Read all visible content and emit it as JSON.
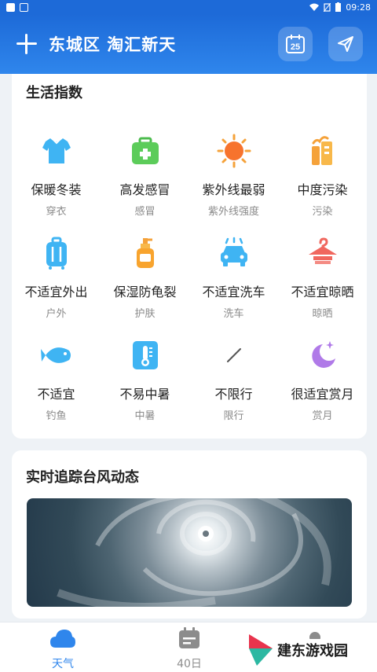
{
  "statusbar": {
    "time": "09:28"
  },
  "header": {
    "location": "东城区 淘汇新天",
    "calendar_day": "25"
  },
  "life_index": {
    "title": "生活指数",
    "items": [
      {
        "value": "保暖冬装",
        "category": "穿衣",
        "icon": "shirt-icon"
      },
      {
        "value": "高发感冒",
        "category": "感冒",
        "icon": "medkit-icon"
      },
      {
        "value": "紫外线最弱",
        "category": "紫外线强度",
        "icon": "sun-icon"
      },
      {
        "value": "中度污染",
        "category": "污染",
        "icon": "pollution-icon"
      },
      {
        "value": "不适宜外出",
        "category": "户外",
        "icon": "luggage-icon"
      },
      {
        "value": "保湿防龟裂",
        "category": "护肤",
        "icon": "lotion-icon"
      },
      {
        "value": "不适宜洗车",
        "category": "洗车",
        "icon": "car-icon"
      },
      {
        "value": "不适宜晾晒",
        "category": "晾晒",
        "icon": "hanger-icon"
      },
      {
        "value": "不适宜",
        "category": "钓鱼",
        "icon": "fish-icon"
      },
      {
        "value": "不易中暑",
        "category": "中暑",
        "icon": "thermometer-icon"
      },
      {
        "value": "不限行",
        "category": "限行",
        "icon": "slash-icon"
      },
      {
        "value": "很适宜赏月",
        "category": "赏月",
        "icon": "moon-icon"
      }
    ]
  },
  "typhoon": {
    "title": "实时追踪台风动态"
  },
  "nav": {
    "weather": "天气",
    "forty_day": "40日"
  },
  "watermark": {
    "text": "建东游戏园"
  },
  "colors": {
    "brand": "#1d6ad8",
    "active_nav": "#2f86ec"
  }
}
